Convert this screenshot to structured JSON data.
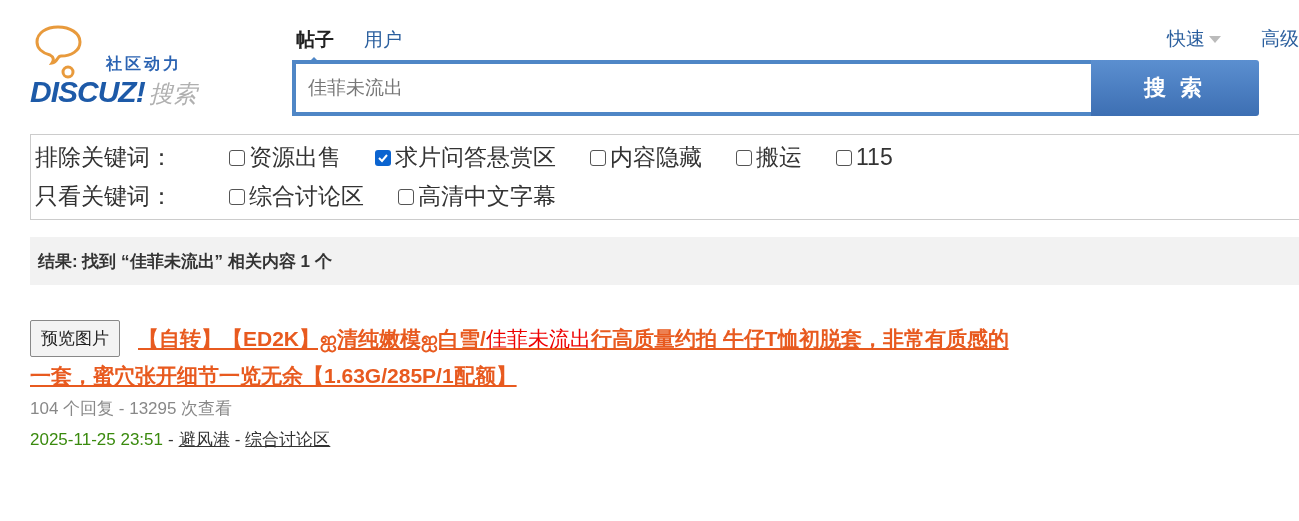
{
  "logo": {
    "tagline": "社区动力",
    "brand": "DISCUZ!",
    "suffix": "搜索"
  },
  "search_tabs": [
    {
      "label": "帖子",
      "selected": true
    },
    {
      "label": "用户",
      "selected": false
    }
  ],
  "top_links": [
    {
      "label": "快速",
      "kind": "dropdown"
    },
    {
      "label": "高级",
      "kind": "link"
    }
  ],
  "search": {
    "value": "佳菲未流出",
    "button": "搜 索"
  },
  "filters": [
    {
      "label": "排除关键词：",
      "options": [
        {
          "label": "资源出售",
          "checked": false
        },
        {
          "label": "求片问答悬赏区",
          "checked": true
        },
        {
          "label": "内容隐藏",
          "checked": false
        },
        {
          "label": "搬运",
          "checked": false
        },
        {
          "label": "115",
          "checked": false
        }
      ]
    },
    {
      "label": "只看关键词：",
      "options": [
        {
          "label": "综合讨论区",
          "checked": false
        },
        {
          "label": "高清中文字幕",
          "checked": false
        }
      ]
    }
  ],
  "result_summary": "结果: 找到 “佳菲未流出” 相关内容 1 个",
  "results": [
    {
      "preview_button": "预览图片",
      "title_lines": [
        [
          {
            "text": "【自转】【ED2K】ஐ清纯嫩模ஐ白雪/",
            "highlight": false
          },
          {
            "text": "佳菲未流出",
            "highlight": true
          },
          {
            "text": "行高质量约拍 牛仔T恤初脱套，非常有质感的",
            "highlight": false
          }
        ],
        [
          {
            "text": "一套，蜜穴张开细节一览无余【1.63G/285P/1配额】",
            "highlight": false
          }
        ]
      ],
      "stats": "104 个回复 - 13295 次查看",
      "date": "2025-11-25 23:51",
      "author": "避风港",
      "forum": "综合讨论区",
      "separators": [
        "-",
        "-"
      ]
    }
  ]
}
